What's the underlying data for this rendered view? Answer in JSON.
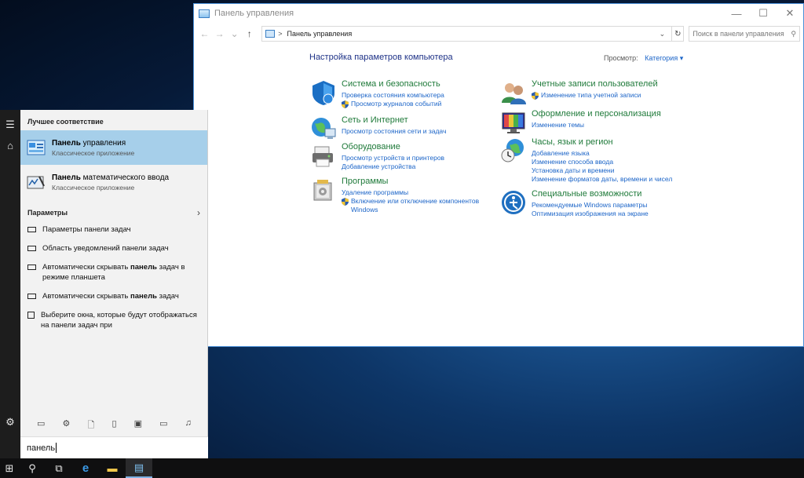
{
  "window": {
    "title": "Панель управления",
    "controls": {
      "minimize": "—",
      "maximize": "☐",
      "close": "✕"
    },
    "nav": {
      "back": "←",
      "forward": "→",
      "dropdown": "⌄",
      "up": "↑"
    },
    "address": {
      "separator": ">",
      "path": "Панель управления",
      "dropdown": "⌄",
      "refresh": "↻"
    },
    "search": {
      "placeholder": "Поиск в панели управления",
      "icon": "⚲"
    }
  },
  "content": {
    "heading": "Настройка параметров компьютера",
    "view_by": {
      "label": "Просмотр:",
      "value": "Категория ▾"
    },
    "categories": [
      {
        "icon": "shield-icon",
        "title": "Система и безопасность",
        "links": [
          {
            "text": "Проверка состояния компьютера",
            "shield": false
          },
          {
            "text": "Просмотр журналов событий",
            "shield": true
          }
        ]
      },
      {
        "icon": "network-icon",
        "title": "Сеть и Интернет",
        "links": [
          {
            "text": "Просмотр состояния сети и задач",
            "shield": false
          }
        ]
      },
      {
        "icon": "printer-icon",
        "title": "Оборудование",
        "links": [
          {
            "text": "Просмотр устройств и принтеров",
            "shield": false
          },
          {
            "text": "Добавление устройства",
            "shield": false
          }
        ]
      },
      {
        "icon": "programs-icon",
        "title": "Программы",
        "links": [
          {
            "text": "Удаление программы",
            "shield": false
          },
          {
            "text": "Включение или отключение компонентов",
            "shield": true
          },
          {
            "text": "Windows",
            "shield": false
          }
        ]
      },
      {
        "icon": "users-icon",
        "title": "Учетные записи пользователей",
        "links": [
          {
            "text": "Изменение типа учетной записи",
            "shield": true
          }
        ]
      },
      {
        "icon": "appearance-icon",
        "title": "Оформление и персонализация",
        "links": [
          {
            "text": "Изменение темы",
            "shield": false
          }
        ]
      },
      {
        "icon": "clock-globe-icon",
        "title": "Часы, язык и регион",
        "links": [
          {
            "text": "Добавление языка",
            "shield": false
          },
          {
            "text": "Изменение способа ввода",
            "shield": false
          },
          {
            "text": "Установка даты и времени",
            "shield": false
          },
          {
            "text": "Изменение форматов даты, времени и чисел",
            "shield": false
          }
        ]
      },
      {
        "icon": "accessibility-icon",
        "title": "Специальные возможности",
        "links": [
          {
            "text": "Рекомендуемые Windows параметры",
            "shield": false
          },
          {
            "text": "Оптимизация изображения на экране",
            "shield": false
          }
        ]
      }
    ]
  },
  "start": {
    "rail": {
      "menu": "☰",
      "home": "⌂",
      "settings": "⚙"
    },
    "best_match_label": "Лучшее соответствие",
    "results": [
      {
        "name_bold": "Панель",
        "name_rest": " управления",
        "sub": "Классическое приложение"
      },
      {
        "name_bold": "Панель",
        "name_rest": " математического ввода",
        "sub": "Классическое приложение"
      }
    ],
    "settings_label": "Параметры",
    "settings_arrow": "›",
    "settings": [
      {
        "pre": "Параметры панели задач",
        "bold": "",
        "post": ""
      },
      {
        "pre": "Область уведомлений панели задач",
        "bold": "",
        "post": ""
      },
      {
        "pre": "Автоматически скрывать ",
        "bold": "панель",
        "post": " задач в режиме планшета"
      },
      {
        "pre": "Автоматически скрывать ",
        "bold": "панель",
        "post": " задач"
      },
      {
        "pre": "Выберите окна, которые будут отображаться на панели задач при",
        "bold": "",
        "post": ""
      }
    ],
    "filters": [
      "▭",
      "⚙",
      "🗋",
      "▯",
      "▣",
      "▭",
      "♫"
    ],
    "query": "панель"
  },
  "taskbar": {
    "start": "⊞",
    "search": "⚲",
    "task_view": "⧉",
    "edge": "e",
    "explorer": "▬",
    "control_panel": "▤"
  },
  "colors": {
    "link": "#1c65c8",
    "category_title": "#1f7a3a",
    "heading": "#1e3287",
    "selection": "#a6cfea"
  }
}
